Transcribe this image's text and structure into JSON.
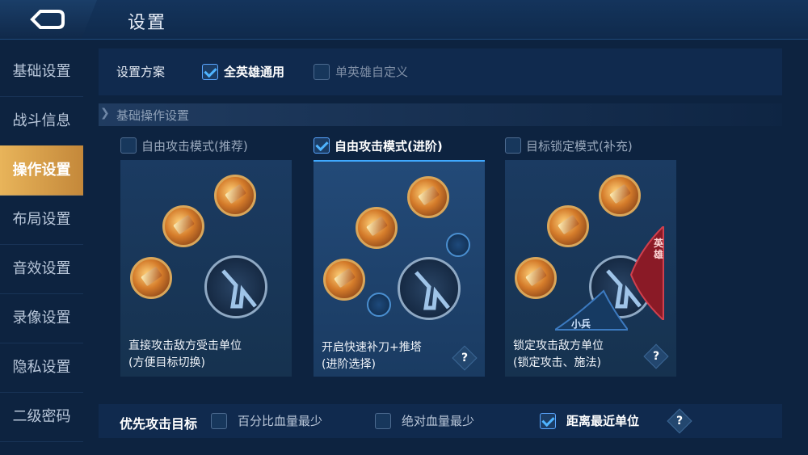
{
  "header": {
    "title": "设置",
    "back_icon": "back-arrow-icon"
  },
  "sidebar": {
    "items": [
      {
        "label": "基础设置",
        "active": false
      },
      {
        "label": "战斗信息",
        "active": false
      },
      {
        "label": "操作设置",
        "active": true
      },
      {
        "label": "布局设置",
        "active": false
      },
      {
        "label": "音效设置",
        "active": false
      },
      {
        "label": "录像设置",
        "active": false
      },
      {
        "label": "隐私设置",
        "active": false
      },
      {
        "label": "二级密码",
        "active": false
      }
    ]
  },
  "scheme": {
    "label": "设置方案",
    "options": [
      {
        "label": "全英雄通用",
        "checked": true
      },
      {
        "label": "单英雄自定义",
        "checked": false
      }
    ]
  },
  "section": {
    "title": "基础操作设置"
  },
  "modes": [
    {
      "title": "自由攻击模式(推荐)",
      "checked": false,
      "desc_line1": "直接攻击敌方受击单位",
      "desc_line2": "(方便目标切换)",
      "has_help": false
    },
    {
      "title": "自由攻击模式(进阶)",
      "checked": true,
      "desc_line1": "开启快速补刀+推塔",
      "desc_line2": "(进阶选择)",
      "has_help": true,
      "help": "?"
    },
    {
      "title": "目标锁定模式(补充)",
      "checked": false,
      "desc_line1": "锁定攻击敌方单位",
      "desc_line2": "(锁定攻击、施法)",
      "has_help": true,
      "help": "?",
      "tag_hero_line1": "英",
      "tag_hero_line2": "雄",
      "tag_minion": "小兵"
    }
  ],
  "priority": {
    "label": "优先攻击目标",
    "options": [
      {
        "label": "百分比血量最少",
        "checked": false
      },
      {
        "label": "绝对血量最少",
        "checked": false
      },
      {
        "label": "距离最近单位",
        "checked": true
      }
    ],
    "help": "?"
  },
  "colors": {
    "accent_gold": "#e8b45a",
    "accent_blue": "#3fa9ff",
    "panel": "#16324f"
  }
}
